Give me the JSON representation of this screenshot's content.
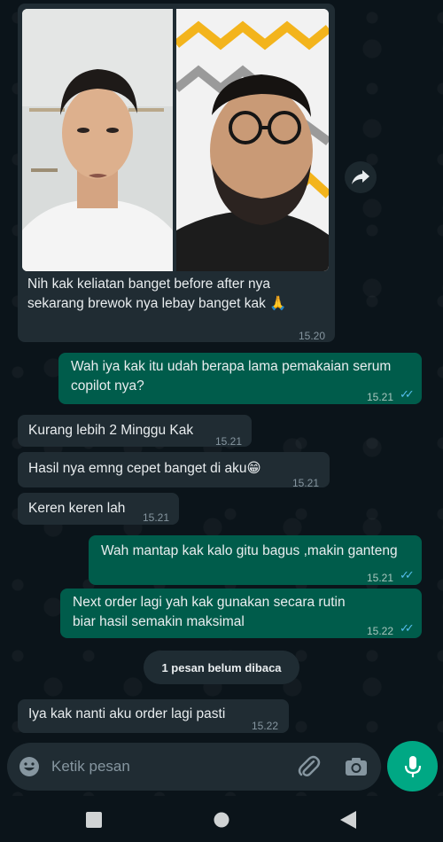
{
  "messages": {
    "photo": {
      "caption": "Nih kak keliatan banget before after nya sekarang brewok nya lebay banget kak 🙏",
      "time": "15.20"
    },
    "m1": {
      "text": "Wah iya kak itu udah berapa lama pemakaian serum copilot nya?",
      "time": "15.21"
    },
    "m2": {
      "text": "Kurang lebih 2 Minggu Kak",
      "time": "15.21"
    },
    "m3": {
      "text": "Hasil nya emng cepet banget di aku😁",
      "time": "15.21"
    },
    "m4": {
      "text": "Keren keren lah",
      "time": "15.21"
    },
    "m5": {
      "text": "Wah mantap kak kalo gitu bagus ,makin ganteng",
      "time": "15.21"
    },
    "m6": {
      "text": "Next order lagi yah kak gunakan secara rutin biar hasil semakin maksimal",
      "time": "15.22"
    },
    "m7": {
      "text": "Iya kak nanti aku order lagi pasti",
      "time": "15.22"
    }
  },
  "unread_banner": "1 pesan belum dibaca",
  "input": {
    "placeholder": "Ketik pesan"
  },
  "colors": {
    "incoming": "#202c33",
    "outgoing": "#005c4b",
    "accent": "#00a884",
    "read_ticks": "#53bdeb"
  },
  "icons": [
    "forward-icon",
    "emoji-icon",
    "attach-icon",
    "camera-icon",
    "mic-icon",
    "nav-recents-icon",
    "nav-home-icon",
    "nav-back-icon"
  ]
}
